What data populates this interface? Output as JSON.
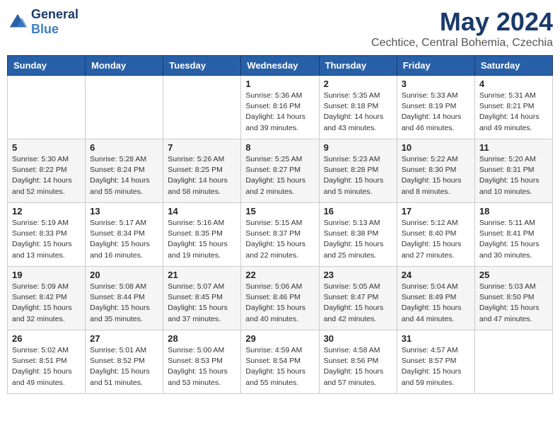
{
  "header": {
    "logo_general": "General",
    "logo_blue": "Blue",
    "month_title": "May 2024",
    "location": "Cechtice, Central Bohemia, Czechia"
  },
  "weekdays": [
    "Sunday",
    "Monday",
    "Tuesday",
    "Wednesday",
    "Thursday",
    "Friday",
    "Saturday"
  ],
  "weeks": [
    [
      {
        "day": "",
        "info": ""
      },
      {
        "day": "",
        "info": ""
      },
      {
        "day": "",
        "info": ""
      },
      {
        "day": "1",
        "info": "Sunrise: 5:36 AM\nSunset: 8:16 PM\nDaylight: 14 hours\nand 39 minutes."
      },
      {
        "day": "2",
        "info": "Sunrise: 5:35 AM\nSunset: 8:18 PM\nDaylight: 14 hours\nand 43 minutes."
      },
      {
        "day": "3",
        "info": "Sunrise: 5:33 AM\nSunset: 8:19 PM\nDaylight: 14 hours\nand 46 minutes."
      },
      {
        "day": "4",
        "info": "Sunrise: 5:31 AM\nSunset: 8:21 PM\nDaylight: 14 hours\nand 49 minutes."
      }
    ],
    [
      {
        "day": "5",
        "info": "Sunrise: 5:30 AM\nSunset: 8:22 PM\nDaylight: 14 hours\nand 52 minutes."
      },
      {
        "day": "6",
        "info": "Sunrise: 5:28 AM\nSunset: 8:24 PM\nDaylight: 14 hours\nand 55 minutes."
      },
      {
        "day": "7",
        "info": "Sunrise: 5:26 AM\nSunset: 8:25 PM\nDaylight: 14 hours\nand 58 minutes."
      },
      {
        "day": "8",
        "info": "Sunrise: 5:25 AM\nSunset: 8:27 PM\nDaylight: 15 hours\nand 2 minutes."
      },
      {
        "day": "9",
        "info": "Sunrise: 5:23 AM\nSunset: 8:28 PM\nDaylight: 15 hours\nand 5 minutes."
      },
      {
        "day": "10",
        "info": "Sunrise: 5:22 AM\nSunset: 8:30 PM\nDaylight: 15 hours\nand 8 minutes."
      },
      {
        "day": "11",
        "info": "Sunrise: 5:20 AM\nSunset: 8:31 PM\nDaylight: 15 hours\nand 10 minutes."
      }
    ],
    [
      {
        "day": "12",
        "info": "Sunrise: 5:19 AM\nSunset: 8:33 PM\nDaylight: 15 hours\nand 13 minutes."
      },
      {
        "day": "13",
        "info": "Sunrise: 5:17 AM\nSunset: 8:34 PM\nDaylight: 15 hours\nand 16 minutes."
      },
      {
        "day": "14",
        "info": "Sunrise: 5:16 AM\nSunset: 8:35 PM\nDaylight: 15 hours\nand 19 minutes."
      },
      {
        "day": "15",
        "info": "Sunrise: 5:15 AM\nSunset: 8:37 PM\nDaylight: 15 hours\nand 22 minutes."
      },
      {
        "day": "16",
        "info": "Sunrise: 5:13 AM\nSunset: 8:38 PM\nDaylight: 15 hours\nand 25 minutes."
      },
      {
        "day": "17",
        "info": "Sunrise: 5:12 AM\nSunset: 8:40 PM\nDaylight: 15 hours\nand 27 minutes."
      },
      {
        "day": "18",
        "info": "Sunrise: 5:11 AM\nSunset: 8:41 PM\nDaylight: 15 hours\nand 30 minutes."
      }
    ],
    [
      {
        "day": "19",
        "info": "Sunrise: 5:09 AM\nSunset: 8:42 PM\nDaylight: 15 hours\nand 32 minutes."
      },
      {
        "day": "20",
        "info": "Sunrise: 5:08 AM\nSunset: 8:44 PM\nDaylight: 15 hours\nand 35 minutes."
      },
      {
        "day": "21",
        "info": "Sunrise: 5:07 AM\nSunset: 8:45 PM\nDaylight: 15 hours\nand 37 minutes."
      },
      {
        "day": "22",
        "info": "Sunrise: 5:06 AM\nSunset: 8:46 PM\nDaylight: 15 hours\nand 40 minutes."
      },
      {
        "day": "23",
        "info": "Sunrise: 5:05 AM\nSunset: 8:47 PM\nDaylight: 15 hours\nand 42 minutes."
      },
      {
        "day": "24",
        "info": "Sunrise: 5:04 AM\nSunset: 8:49 PM\nDaylight: 15 hours\nand 44 minutes."
      },
      {
        "day": "25",
        "info": "Sunrise: 5:03 AM\nSunset: 8:50 PM\nDaylight: 15 hours\nand 47 minutes."
      }
    ],
    [
      {
        "day": "26",
        "info": "Sunrise: 5:02 AM\nSunset: 8:51 PM\nDaylight: 15 hours\nand 49 minutes."
      },
      {
        "day": "27",
        "info": "Sunrise: 5:01 AM\nSunset: 8:52 PM\nDaylight: 15 hours\nand 51 minutes."
      },
      {
        "day": "28",
        "info": "Sunrise: 5:00 AM\nSunset: 8:53 PM\nDaylight: 15 hours\nand 53 minutes."
      },
      {
        "day": "29",
        "info": "Sunrise: 4:59 AM\nSunset: 8:54 PM\nDaylight: 15 hours\nand 55 minutes."
      },
      {
        "day": "30",
        "info": "Sunrise: 4:58 AM\nSunset: 8:56 PM\nDaylight: 15 hours\nand 57 minutes."
      },
      {
        "day": "31",
        "info": "Sunrise: 4:57 AM\nSunset: 8:57 PM\nDaylight: 15 hours\nand 59 minutes."
      },
      {
        "day": "",
        "info": ""
      }
    ]
  ]
}
